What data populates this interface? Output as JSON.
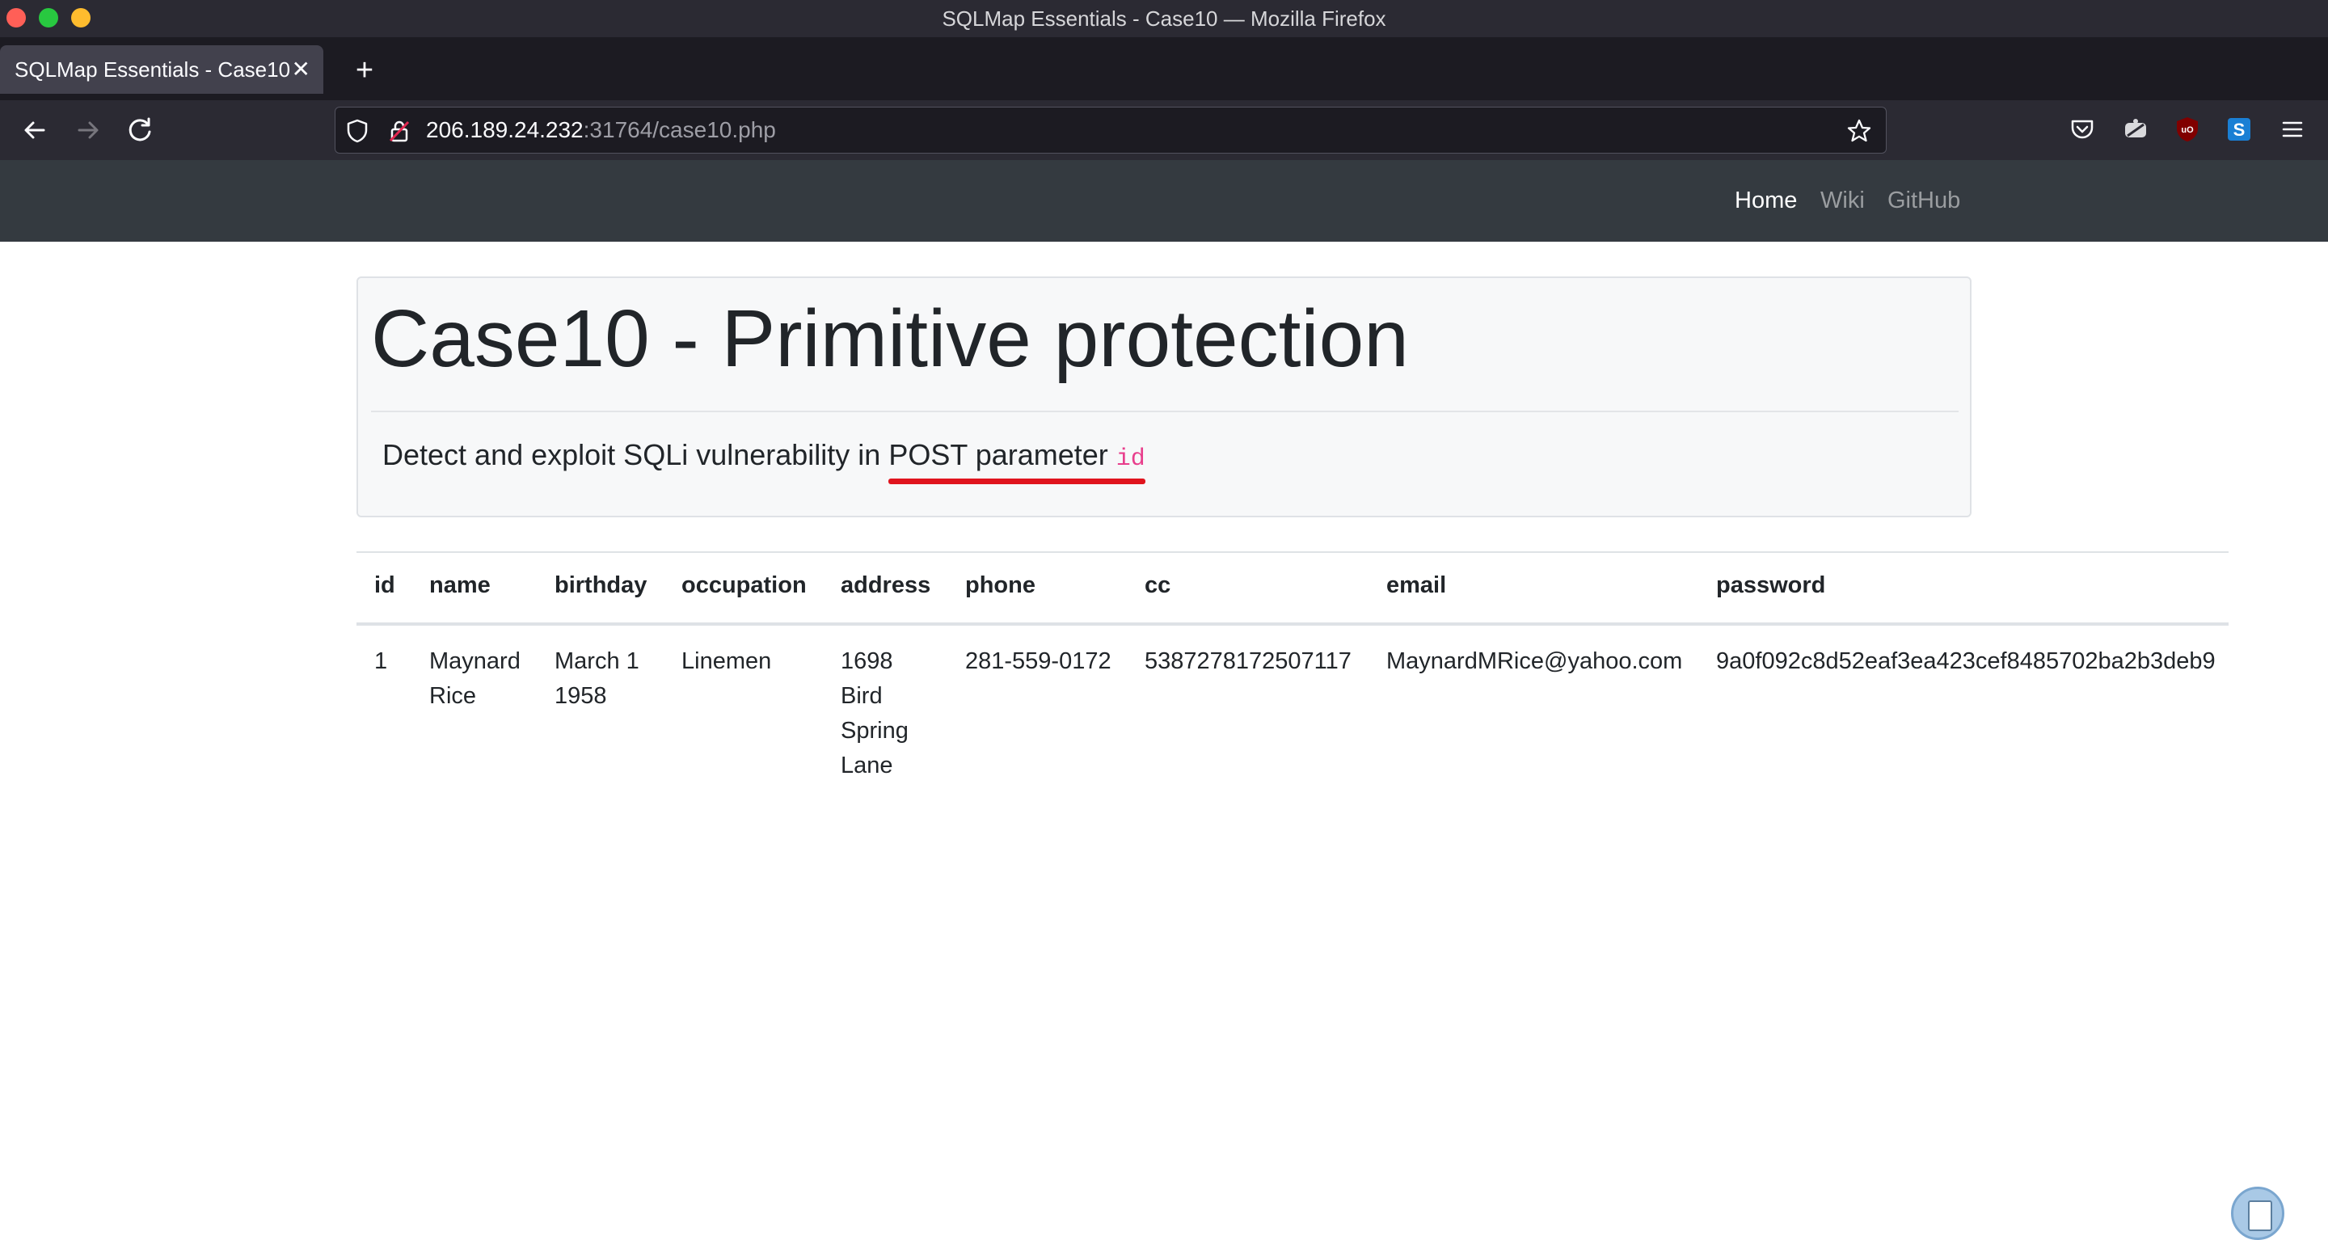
{
  "window": {
    "title": "SQLMap Essentials - Case10 — Mozilla Firefox"
  },
  "tabs": [
    {
      "label": "SQLMap Essentials - Case10",
      "active": true
    }
  ],
  "urlbar": {
    "host": "206.189.24.232",
    "path": ":31764/case10.php"
  },
  "toolbar_icons": [
    "back-icon",
    "forward-icon",
    "reload-icon",
    "shield-icon",
    "lock-icon",
    "bookmark-star-icon",
    "pocket-icon",
    "extension-icon",
    "ublock-icon",
    "s-extension-icon",
    "menu-icon"
  ],
  "site_nav": {
    "home": "Home",
    "wiki": "Wiki",
    "github": "GitHub"
  },
  "jumbotron": {
    "heading": "Case10 - Primitive protection",
    "lead_prefix": "Detect and exploit SQLi vulnerability in ",
    "lead_highlight": "POST parameter ",
    "lead_code": "id"
  },
  "table": {
    "headers": [
      "id",
      "name",
      "birthday",
      "occupation",
      "address",
      "phone",
      "cc",
      "email",
      "password"
    ],
    "rows": [
      {
        "id": "1",
        "name_lines": [
          "Maynard",
          "Rice"
        ],
        "birthday_lines": [
          "March 1",
          "1958"
        ],
        "occupation": "Linemen",
        "address_lines": [
          "1698",
          "Bird",
          "Spring",
          "Lane"
        ],
        "phone": "281-559-0172",
        "cc": "5387278172507117",
        "email": "MaynardMRice@yahoo.com",
        "password": "9a0f092c8d52eaf3ea423cef8485702ba2b3deb9"
      }
    ]
  },
  "colors": {
    "site_nav_bg": "#343a40",
    "underline": "#e0141e",
    "code": "#e83e8c"
  }
}
